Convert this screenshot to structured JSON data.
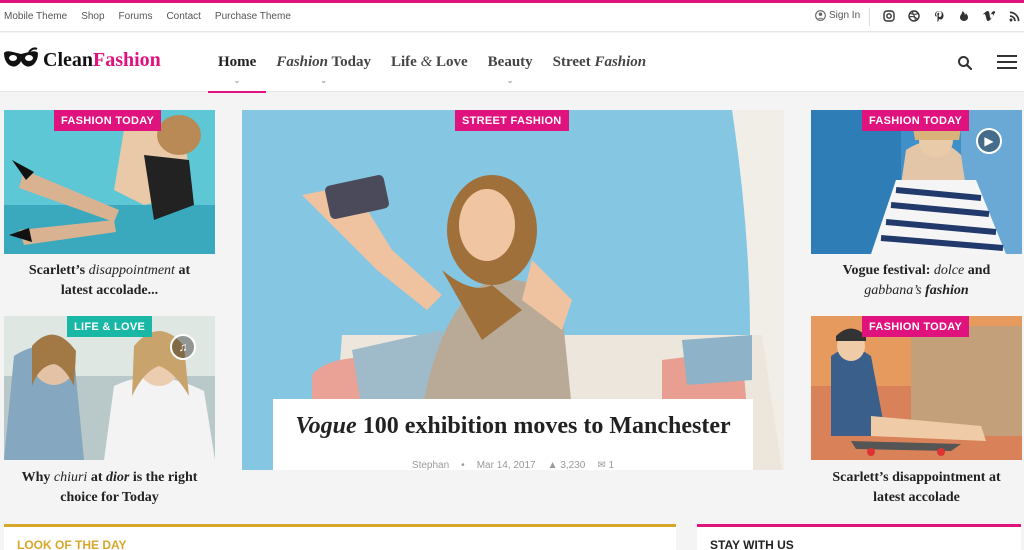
{
  "topbar": {
    "links": [
      "Mobile Theme",
      "Shop",
      "Forums",
      "Contact",
      "Purchase Theme"
    ],
    "signin": "Sign In",
    "social_icons": [
      "instagram-icon",
      "dribbble-icon",
      "pinterest-icon",
      "fire-icon",
      "vimeo-icon",
      "rss-icon"
    ]
  },
  "header": {
    "logo_word1": "Clean",
    "logo_word2": "Fashion",
    "nav": {
      "home": "Home",
      "fashion_today_a": "Fashion",
      "fashion_today_b": " Today",
      "life_a": "Life ",
      "life_amp": "&",
      "life_b": " Love",
      "beauty": "Beauty",
      "street_a": "Street ",
      "street_b": "Fashion"
    }
  },
  "cards": {
    "c1": {
      "badge": "FASHION TODAY",
      "t1": "Scarlett’s ",
      "t2": "disappointment",
      "t3": " at",
      "t4": "latest accolade..."
    },
    "c2": {
      "badge": "LIFE & LOVE",
      "t1": "Why ",
      "t2": "chiuri",
      "t3": " at ",
      "t4": "dior",
      "t5": " is the right",
      "t6": "choice for Today"
    },
    "c3": {
      "badge": "FASHION TODAY",
      "t1": "Vogue festival: ",
      "t2": "dolce",
      "t3": " and",
      "t4": "gabbana’s ",
      "t5": "fashion"
    },
    "c4": {
      "badge": "FASHION TODAY",
      "t1": "Scarlett’s disappointment at",
      "t2": "latest accolade"
    }
  },
  "hero": {
    "badge": "STREET FASHION",
    "title_a": "Vogue",
    "title_b": " 100 exhibition moves to Manchester",
    "author": "Stephan",
    "date": "Mar 14, 2017",
    "views": "3,230",
    "comments": "1"
  },
  "sections": {
    "left": "LOOK OF THE DAY",
    "right": "STAY WITH US"
  },
  "colors": {
    "accent": "#e0127e",
    "teal": "#19b8a6",
    "gold": "#d6a72a"
  }
}
